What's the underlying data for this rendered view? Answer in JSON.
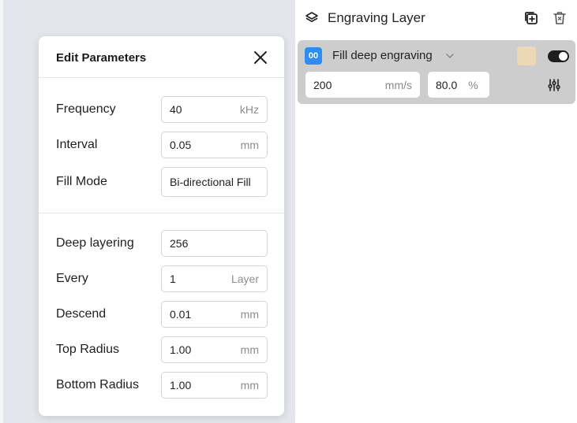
{
  "layer_panel": {
    "title": "Engraving Layer",
    "layer": {
      "badge": "00",
      "name": "Fill deep engraving",
      "speed_value": "200",
      "speed_unit": "mm/s",
      "power_value": "80.0",
      "power_unit": "%",
      "enabled": true,
      "swatch_color": "#ecd8b4"
    }
  },
  "dialog": {
    "title": "Edit Parameters",
    "section1": [
      {
        "label": "Frequency",
        "value": "40",
        "unit": "kHz"
      },
      {
        "label": "Interval",
        "value": "0.05",
        "unit": "mm"
      },
      {
        "label": "Fill Mode",
        "value": "Bi-directional Fill",
        "unit": ""
      }
    ],
    "section2": [
      {
        "label": "Deep layering",
        "value": "256",
        "unit": ""
      },
      {
        "label": "Every",
        "value": "1",
        "unit": "Layer"
      },
      {
        "label": "Descend",
        "value": "0.01",
        "unit": "mm"
      },
      {
        "label": "Top Radius",
        "value": "1.00",
        "unit": "mm"
      },
      {
        "label": "Bottom Radius",
        "value": "1.00",
        "unit": "mm"
      }
    ]
  },
  "colors": {
    "badge": "#2f8cf0",
    "background": "#e3e6ec",
    "layer_card": "#cdcdcd"
  }
}
